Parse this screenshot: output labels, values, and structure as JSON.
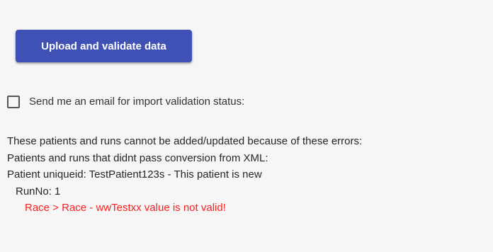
{
  "upload": {
    "label": "Upload and validate data"
  },
  "email_option": {
    "label": "Send me an email for import validation status:",
    "checked": false
  },
  "errors": {
    "summary": "These patients and runs cannot be added/updated because of these errors:",
    "conversion_heading": "Patients and runs that didnt pass conversion from XML:",
    "patient_line": "Patient uniqueid: TestPatient123s - This patient is new",
    "run_line": "RunNo: 1",
    "error_message": "Race > Race - wwTestxx value is not valid!"
  },
  "colors": {
    "button": "#3f51b5",
    "error": "#ff1f1f",
    "background": "#f6f6f6"
  }
}
